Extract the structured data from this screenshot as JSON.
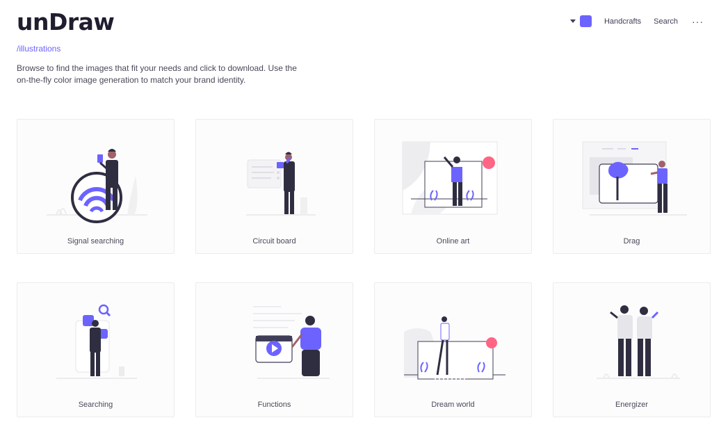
{
  "header": {
    "logo": "unDraw",
    "accent_color": "#6c63ff",
    "nav": {
      "handcrafts": "Handcrafts",
      "search": "Search",
      "more": "···"
    }
  },
  "subtitle_link": "/illustrations",
  "intro": "Browse to find the images that fit your needs and click to download. Use the on-the-fly color image generation to match your brand identity.",
  "illustrations": [
    {
      "label": "Signal searching"
    },
    {
      "label": "Circuit board"
    },
    {
      "label": "Online art"
    },
    {
      "label": "Drag"
    },
    {
      "label": "Searching"
    },
    {
      "label": "Functions"
    },
    {
      "label": "Dream world"
    },
    {
      "label": "Energizer"
    }
  ]
}
